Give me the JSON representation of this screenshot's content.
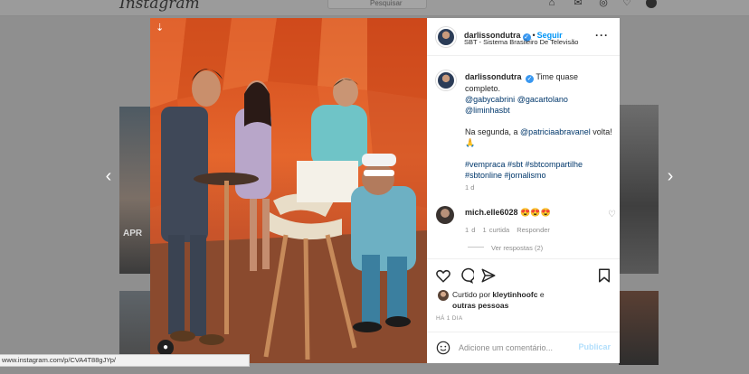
{
  "background": {
    "logo_text": "Instagram",
    "search_placeholder": "Pesquisar",
    "tile_label": "APR",
    "nav_icons": [
      "home-icon",
      "messenger-icon",
      "explore-icon",
      "heart-icon",
      "profile-avatar"
    ]
  },
  "post": {
    "username": "darlissondutra",
    "follow_label": "Seguir",
    "location": "SBT - Sistema Brasileiro De Televisão",
    "more_label": "···",
    "caption": {
      "username": "darlissondutra",
      "line1": "Time quase completo.",
      "mention1": "@gabycabrini",
      "mention2": "@gacartolano",
      "mention3": "@liminhasbt",
      "line2_pre": "Na segunda, a ",
      "mention4": "@patriciaabravanel",
      "line2_post": " volta! 🙏",
      "hashtags": "#vempraca #sbt #sbtcompartilhe #sbtonline #jornalismo",
      "time": "1 d"
    },
    "comment": {
      "username": "mich.elle6028",
      "text": "😍😍😍",
      "time": "1 d",
      "likes": "1 curtida",
      "reply": "Responder",
      "view_replies": "Ver respostas (2)"
    },
    "liked_by": {
      "prefix": "Curtido por ",
      "user": "kleytinhoofc",
      "mid": " e",
      "others": "outras pessoas"
    },
    "post_time": "HÁ 1 DIA",
    "add_comment_placeholder": "Adicione um comentário...",
    "publish_label": "Publicar"
  },
  "status_url": "www.instagram.com/p/CVA4T88gJYp/",
  "colors": {
    "accent": "#0095f6",
    "verified": "#3897f0",
    "publish_disabled": "#b2dffc"
  }
}
